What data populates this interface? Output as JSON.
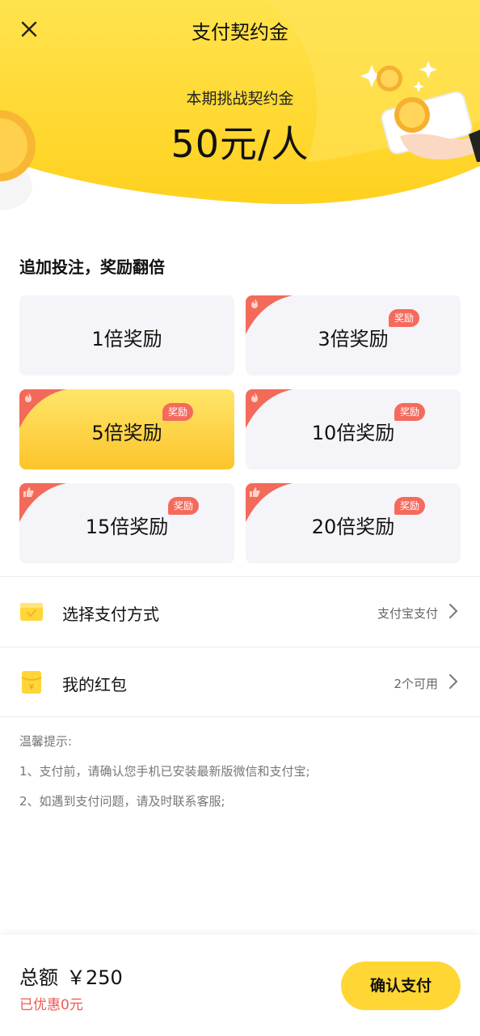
{
  "nav": {
    "title": "支付契约金"
  },
  "hero": {
    "subtitle": "本期挑战契约金",
    "amount": "50元/人"
  },
  "multipliers": {
    "section_title": "追加投注，奖励翻倍",
    "options": [
      {
        "label": "1倍奖励",
        "badge": null,
        "corner_icon": null,
        "selected": false
      },
      {
        "label": "3倍奖励",
        "badge": "奖励",
        "corner_icon": "fire-icon",
        "selected": false
      },
      {
        "label": "5倍奖励",
        "badge": "奖励",
        "corner_icon": "fire-icon",
        "selected": true
      },
      {
        "label": "10倍奖励",
        "badge": "奖励",
        "corner_icon": "fire-icon",
        "selected": false
      },
      {
        "label": "15倍奖励",
        "badge": "奖励",
        "corner_icon": "thumbs-up-icon",
        "selected": false
      },
      {
        "label": "20倍奖励",
        "badge": "奖励",
        "corner_icon": "thumbs-up-icon",
        "selected": false
      }
    ]
  },
  "payment": {
    "label": "选择支付方式",
    "value": "支付宝支付",
    "icon": "wallet-icon"
  },
  "red_packet": {
    "label": "我的红包",
    "value": "2个可用",
    "icon": "red-packet-icon"
  },
  "tips": {
    "title": "温馨提示:",
    "items": [
      "1、支付前，请确认您手机已安装最新版微信和支付宝;",
      "2、如遇到支付问题，请及时联系客服;"
    ]
  },
  "footer": {
    "total_label": "总额",
    "total_amount": "￥250",
    "discount": "已优惠0元",
    "pay_button": "确认支付"
  },
  "colors": {
    "accent_yellow": "#FFD633",
    "badge_red": "#F56A5C",
    "discount_red": "#F0584F"
  }
}
